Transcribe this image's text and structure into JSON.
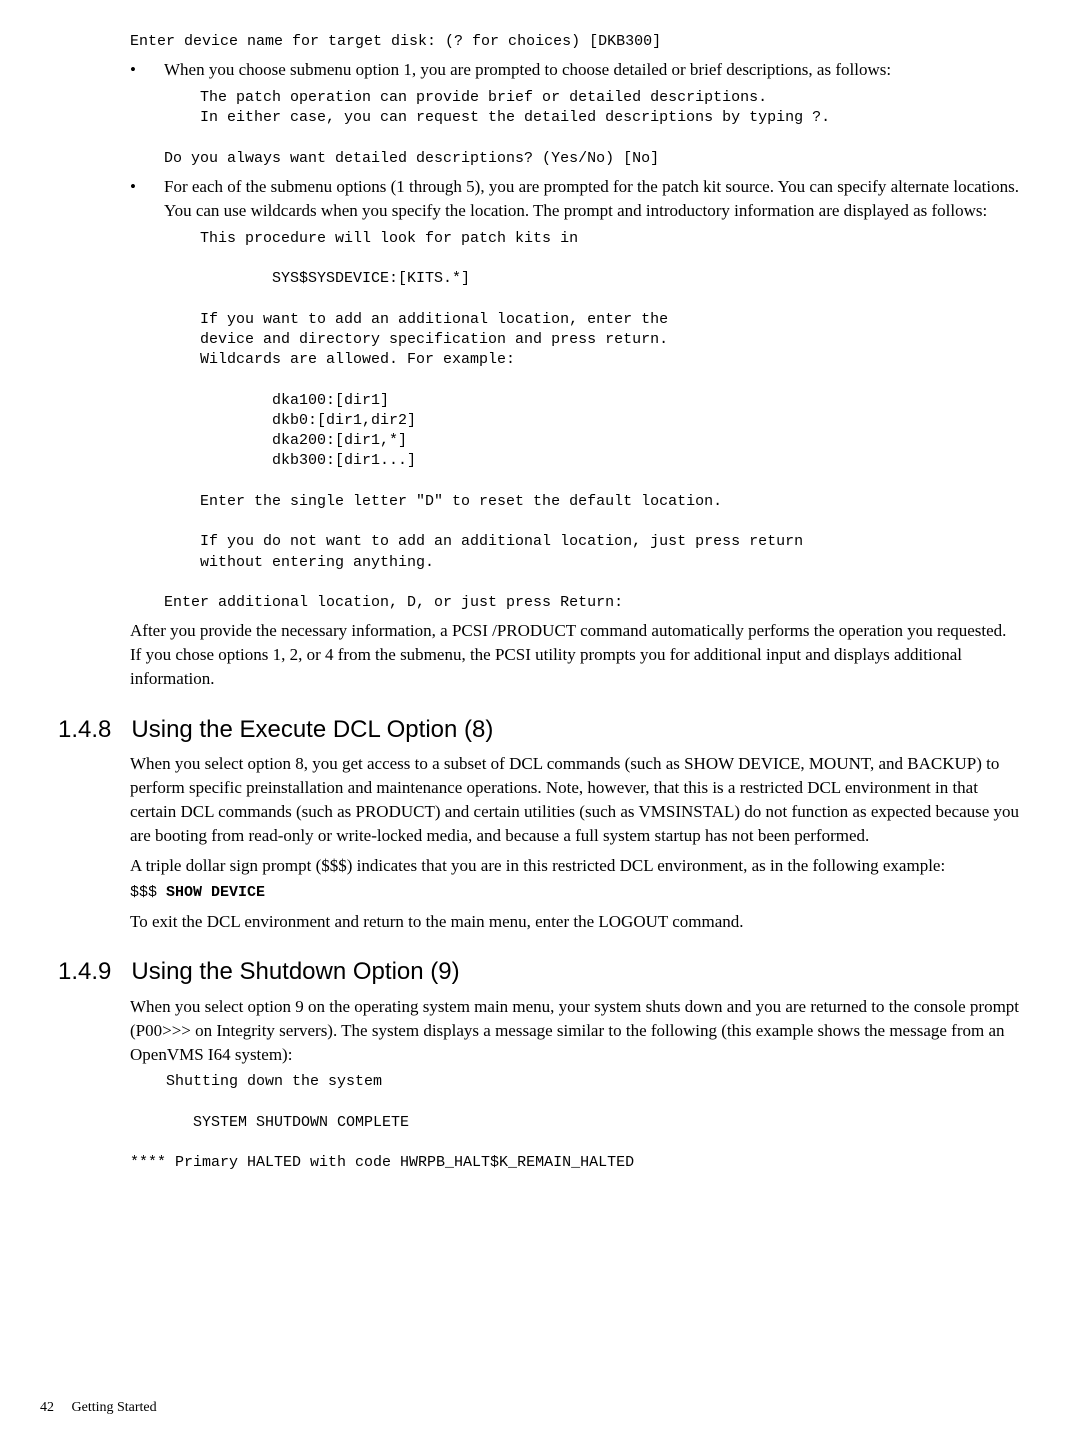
{
  "block1_code": "Enter device name for target disk: (? for choices) [DKB300]",
  "bullet1_text": "When you choose submenu option 1, you are prompted to choose detailed or brief descriptions, as follows:",
  "bullet1_code1": "    The patch operation can provide brief or detailed descriptions.\n    In either case, you can request the detailed descriptions by typing ?.\n\nDo you always want detailed descriptions? (Yes/No) [No]",
  "bullet2_text": "For each of the submenu options (1 through 5), you are prompted for the patch kit source. You can specify alternate locations. You can use wildcards when you specify the location. The prompt and introductory information are displayed as follows:",
  "bullet2_code1": "    This procedure will look for patch kits in\n\n            SYS$SYSDEVICE:[KITS.*]\n\n    If you want to add an additional location, enter the\n    device and directory specification and press return.\n    Wildcards are allowed. For example:\n\n            dka100:[dir1]\n            dkb0:[dir1,dir2]\n            dka200:[dir1,*]\n            dkb300:[dir1...]\n\n    Enter the single letter \"D\" to reset the default location.\n\n    If you do not want to add an additional location, just press return\n    without entering anything.\n\nEnter additional location, D, or just press Return:",
  "after_bullets_para": "After you provide the necessary information, a PCSI /PRODUCT command automatically performs the operation you requested. If you chose options 1, 2, or 4 from the submenu, the PCSI utility prompts you for additional input and displays additional information.",
  "sec148_num": "1.4.8",
  "sec148_title": "Using the Execute DCL Option (8)",
  "sec148_para1": "When you select option 8, you get access to a subset of DCL commands (such as SHOW DEVICE, MOUNT, and BACKUP) to perform specific preinstallation and maintenance operations. Note, however, that this is a restricted DCL environment in that certain DCL commands (such as PRODUCT) and certain utilities (such as VMSINSTAL) do not function as expected because you are booting from read-only or write-locked media, and because a full system startup has not been performed.",
  "sec148_para2": "A triple dollar sign prompt ($$$) indicates that you are in this restricted DCL environment, as in the following example:",
  "sec148_code_prefix": "$$$ ",
  "sec148_code_bold": "SHOW DEVICE",
  "sec148_para3": "To exit the DCL environment and return to the main menu, enter the LOGOUT command.",
  "sec149_num": "1.4.9",
  "sec149_title": "Using the Shutdown Option (9)",
  "sec149_para1": "When you select option 9 on the operating system main menu, your system shuts down and you are returned to the console prompt (P00>>> on Integrity servers). The system displays a message similar to the following (this example shows the message from an OpenVMS I64 system):",
  "sec149_code1": "    Shutting down the system\n\n       SYSTEM SHUTDOWN COMPLETE\n\n**** Primary HALTED with code HWRPB_HALT$K_REMAIN_HALTED",
  "footer_page": "42",
  "footer_title": "Getting Started"
}
